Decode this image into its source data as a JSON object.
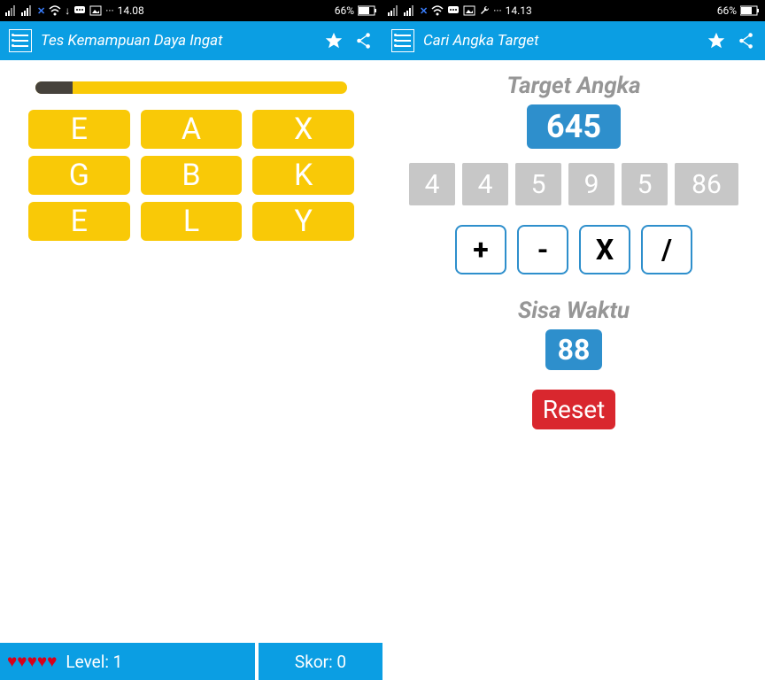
{
  "statusBar": {
    "left": {
      "timeA": "14.08",
      "timeB": "14.13",
      "batteryText": "66%"
    },
    "right": {
      "batteryText": "66%"
    }
  },
  "screenA": {
    "title": "Tes Kemampuan Daya Ingat",
    "letters": [
      "E",
      "A",
      "X",
      "G",
      "B",
      "K",
      "E",
      "L",
      "Y"
    ],
    "levelLabel": "Level: 1",
    "scoreLabel": "Skor: 0",
    "hearts": 5
  },
  "screenB": {
    "title": "Cari Angka Target",
    "targetLabel": "Target Angka",
    "targetValue": "645",
    "numbers": [
      "4",
      "4",
      "5",
      "9",
      "5",
      "86"
    ],
    "ops": [
      "+",
      "-",
      "X",
      "/"
    ],
    "timeLabel": "Sisa Waktu",
    "timeValue": "88",
    "resetLabel": "Reset"
  }
}
